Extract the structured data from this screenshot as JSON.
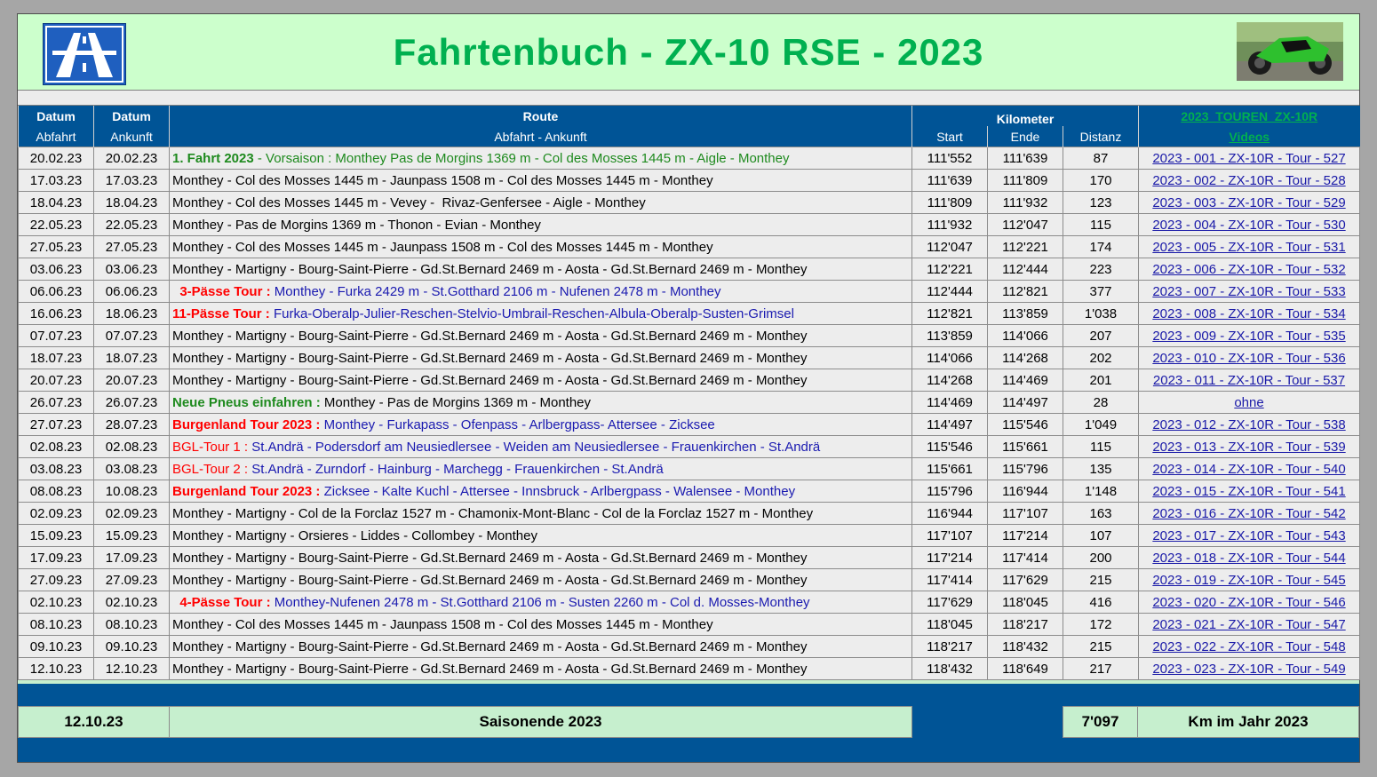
{
  "title": "Fahrtenbuch - ZX-10 RSE - 2023",
  "colors": {
    "header_blue": "#005496",
    "title_green": "#00b050",
    "red": "#ff0000",
    "blue": "#1a1ab0"
  },
  "icons": {
    "logo": "autobahn-sign-icon",
    "photo": "motorcycle-photo"
  },
  "columns": {
    "datum1": "Datum",
    "datum1_sub": "Abfahrt",
    "datum2": "Datum",
    "datum2_sub": "Ankunft",
    "route": "Route",
    "route_sub": "Abfahrt - Ankunft",
    "kilometer": "Kilometer",
    "start": "Start",
    "ende": "Ende",
    "distanz": "Distanz",
    "videos_link": "2023_TOUREN_ZX-10R",
    "videos": "Videos"
  },
  "rows": [
    {
      "abfahrt": "20.02.23",
      "ankunft": "20.02.23",
      "label": "1. Fahrt 2023",
      "label_style": "t-greenb",
      "route": " - Vorsaison : Monthey Pas de Morgins 1369 m - Col des Mosses 1445 m - Aigle - Monthey",
      "route_style": "t-green",
      "start": "111'552",
      "ende": "111'639",
      "distanz": "87",
      "video": "2023 - 001 - ZX-10R - Tour - 527"
    },
    {
      "abfahrt": "17.03.23",
      "ankunft": "17.03.23",
      "label": "",
      "label_style": "",
      "route": "Monthey - Col des Mosses 1445 m - Jaunpass 1508 m - Col des Mosses 1445 m - Monthey",
      "route_style": "t-black",
      "start": "111'639",
      "ende": "111'809",
      "distanz": "170",
      "video": "2023 - 002 - ZX-10R - Tour - 528"
    },
    {
      "abfahrt": "18.04.23",
      "ankunft": "18.04.23",
      "label": "",
      "label_style": "",
      "route": "Monthey - Col des Mosses 1445 m - Vevey -  Rivaz-Genfersee - Aigle - Monthey",
      "route_style": "t-black",
      "start": "111'809",
      "ende": "111'932",
      "distanz": "123",
      "video": "2023 - 003 - ZX-10R - Tour - 529"
    },
    {
      "abfahrt": "22.05.23",
      "ankunft": "22.05.23",
      "label": "",
      "label_style": "",
      "route": "Monthey - Pas de Morgins 1369 m - Thonon - Evian - Monthey",
      "route_style": "t-black",
      "start": "111'932",
      "ende": "112'047",
      "distanz": "115",
      "video": "2023 - 004 - ZX-10R - Tour - 530"
    },
    {
      "abfahrt": "27.05.23",
      "ankunft": "27.05.23",
      "label": "",
      "label_style": "",
      "route": "Monthey - Col des Mosses 1445 m - Jaunpass 1508 m - Col des Mosses 1445 m - Monthey",
      "route_style": "t-black",
      "start": "112'047",
      "ende": "112'221",
      "distanz": "174",
      "video": "2023 - 005 - ZX-10R - Tour - 531"
    },
    {
      "abfahrt": "03.06.23",
      "ankunft": "03.06.23",
      "label": "",
      "label_style": "",
      "route": "Monthey - Martigny - Bourg-Saint-Pierre - Gd.St.Bernard 2469 m - Aosta - Gd.St.Bernard 2469 m - Monthey",
      "route_style": "t-black",
      "start": "112'221",
      "ende": "112'444",
      "distanz": "223",
      "video": "2023 - 006 - ZX-10R - Tour - 532"
    },
    {
      "abfahrt": "06.06.23",
      "ankunft": "06.06.23",
      "label": "  3-Pässe Tour :",
      "label_style": "t-redb",
      "route": " Monthey - Furka 2429 m - St.Gotthard 2106 m - Nufenen 2478 m - Monthey",
      "route_style": "t-blue",
      "start": "112'444",
      "ende": "112'821",
      "distanz": "377",
      "video": "2023 - 007 - ZX-10R - Tour - 533"
    },
    {
      "abfahrt": "16.06.23",
      "ankunft": "18.06.23",
      "label": "11-Pässe Tour :",
      "label_style": "t-redb",
      "route": " Furka-Oberalp-Julier-Reschen-Stelvio-Umbrail-Reschen-Albula-Oberalp-Susten-Grimsel",
      "route_style": "t-blue",
      "start": "112'821",
      "ende": "113'859",
      "distanz": "1'038",
      "video": "2023 - 008 - ZX-10R - Tour - 534"
    },
    {
      "abfahrt": "07.07.23",
      "ankunft": "07.07.23",
      "label": "",
      "label_style": "",
      "route": "Monthey - Martigny - Bourg-Saint-Pierre - Gd.St.Bernard 2469 m - Aosta - Gd.St.Bernard 2469 m - Monthey",
      "route_style": "t-black",
      "start": "113'859",
      "ende": "114'066",
      "distanz": "207",
      "video": "2023 - 009 - ZX-10R - Tour - 535"
    },
    {
      "abfahrt": "18.07.23",
      "ankunft": "18.07.23",
      "label": "",
      "label_style": "",
      "route": "Monthey - Martigny - Bourg-Saint-Pierre - Gd.St.Bernard 2469 m - Aosta - Gd.St.Bernard 2469 m - Monthey",
      "route_style": "t-black",
      "start": "114'066",
      "ende": "114'268",
      "distanz": "202",
      "video": "2023 - 010 - ZX-10R - Tour - 536"
    },
    {
      "abfahrt": "20.07.23",
      "ankunft": "20.07.23",
      "label": "",
      "label_style": "",
      "route": "Monthey - Martigny - Bourg-Saint-Pierre - Gd.St.Bernard 2469 m - Aosta - Gd.St.Bernard 2469 m - Monthey",
      "route_style": "t-black",
      "start": "114'268",
      "ende": "114'469",
      "distanz": "201",
      "video": "2023 - 011 - ZX-10R - Tour - 537"
    },
    {
      "abfahrt": "26.07.23",
      "ankunft": "26.07.23",
      "label": "Neue Pneus einfahren :",
      "label_style": "t-greenb",
      "route": " Monthey - Pas de Morgins 1369 m - Monthey",
      "route_style": "t-black",
      "start": "114'469",
      "ende": "114'497",
      "distanz": "28",
      "video": "ohne"
    },
    {
      "abfahrt": "27.07.23",
      "ankunft": "28.07.23",
      "label": "Burgenland Tour 2023 :",
      "label_style": "t-redb",
      "route": " Monthey - Furkapass - Ofenpass - Arlbergpass- Attersee - Zicksee",
      "route_style": "t-blue",
      "start": "114'497",
      "ende": "115'546",
      "distanz": "1'049",
      "video": "2023 - 012 - ZX-10R - Tour - 538"
    },
    {
      "abfahrt": "02.08.23",
      "ankunft": "02.08.23",
      "label": "BGL-Tour 1 :",
      "label_style": "t-red",
      "route": " St.Andrä - Podersdorf am Neusiedlersee - Weiden am Neusiedlersee - Frauenkirchen - St.Andrä",
      "route_style": "t-blue",
      "start": "115'546",
      "ende": "115'661",
      "distanz": "115",
      "video": "2023 - 013 - ZX-10R - Tour - 539"
    },
    {
      "abfahrt": "03.08.23",
      "ankunft": "03.08.23",
      "label": "BGL-Tour 2 :",
      "label_style": "t-red",
      "route": " St.Andrä - Zurndorf - Hainburg - Marchegg - Frauenkirchen - St.Andrä",
      "route_style": "t-blue",
      "start": "115'661",
      "ende": "115'796",
      "distanz": "135",
      "video": "2023 - 014 - ZX-10R - Tour - 540"
    },
    {
      "abfahrt": "08.08.23",
      "ankunft": "10.08.23",
      "label": "Burgenland Tour 2023 :",
      "label_style": "t-redb",
      "route": " Zicksee - Kalte Kuchl - Attersee - Innsbruck - Arlbergpass - Walensee - Monthey",
      "route_style": "t-blue",
      "start": "115'796",
      "ende": "116'944",
      "distanz": "1'148",
      "video": "2023 - 015 - ZX-10R - Tour - 541"
    },
    {
      "abfahrt": "02.09.23",
      "ankunft": "02.09.23",
      "label": "",
      "label_style": "",
      "route": "Monthey - Martigny - Col de la Forclaz 1527 m - Chamonix-Mont-Blanc - Col de la Forclaz 1527 m - Monthey",
      "route_style": "t-black",
      "start": "116'944",
      "ende": "117'107",
      "distanz": "163",
      "video": "2023 - 016 - ZX-10R - Tour - 542"
    },
    {
      "abfahrt": "15.09.23",
      "ankunft": "15.09.23",
      "label": "",
      "label_style": "",
      "route": "Monthey - Martigny - Orsieres - Liddes - Collombey - Monthey",
      "route_style": "t-black",
      "start": "117'107",
      "ende": "117'214",
      "distanz": "107",
      "video": "2023 - 017 - ZX-10R - Tour - 543"
    },
    {
      "abfahrt": "17.09.23",
      "ankunft": "17.09.23",
      "label": "",
      "label_style": "",
      "route": "Monthey - Martigny - Bourg-Saint-Pierre - Gd.St.Bernard 2469 m - Aosta - Gd.St.Bernard 2469 m - Monthey",
      "route_style": "t-black",
      "start": "117'214",
      "ende": "117'414",
      "distanz": "200",
      "video": "2023 - 018 - ZX-10R - Tour - 544"
    },
    {
      "abfahrt": "27.09.23",
      "ankunft": "27.09.23",
      "label": "",
      "label_style": "",
      "route": "Monthey - Martigny - Bourg-Saint-Pierre - Gd.St.Bernard 2469 m - Aosta - Gd.St.Bernard 2469 m - Monthey",
      "route_style": "t-black",
      "start": "117'414",
      "ende": "117'629",
      "distanz": "215",
      "video": "2023 - 019 - ZX-10R - Tour - 545"
    },
    {
      "abfahrt": "02.10.23",
      "ankunft": "02.10.23",
      "label": "  4-Pässe Tour :",
      "label_style": "t-redb",
      "route": " Monthey-Nufenen 2478 m - St.Gotthard 2106 m - Susten 2260 m - Col d. Mosses-Monthey",
      "route_style": "t-blue",
      "start": "117'629",
      "ende": "118'045",
      "distanz": "416",
      "video": "2023 - 020 - ZX-10R - Tour - 546"
    },
    {
      "abfahrt": "08.10.23",
      "ankunft": "08.10.23",
      "label": "",
      "label_style": "",
      "route": "Monthey - Col des Mosses 1445 m - Jaunpass 1508 m - Col des Mosses 1445 m - Monthey",
      "route_style": "t-black",
      "start": "118'045",
      "ende": "118'217",
      "distanz": "172",
      "video": "2023 - 021 - ZX-10R - Tour - 547"
    },
    {
      "abfahrt": "09.10.23",
      "ankunft": "09.10.23",
      "label": "",
      "label_style": "",
      "route": "Monthey - Martigny - Bourg-Saint-Pierre - Gd.St.Bernard 2469 m - Aosta - Gd.St.Bernard 2469 m - Monthey",
      "route_style": "t-black",
      "start": "118'217",
      "ende": "118'432",
      "distanz": "215",
      "video": "2023 - 022 - ZX-10R - Tour - 548"
    },
    {
      "abfahrt": "12.10.23",
      "ankunft": "12.10.23",
      "label": "",
      "label_style": "",
      "route": "Monthey - Martigny - Bourg-Saint-Pierre - Gd.St.Bernard 2469 m - Aosta - Gd.St.Bernard 2469 m - Monthey",
      "route_style": "t-black",
      "start": "118'432",
      "ende": "118'649",
      "distanz": "217",
      "video": "2023 - 023 - ZX-10R - Tour - 549"
    }
  ],
  "footer": {
    "date": "12.10.23",
    "label": "Saisonende 2023",
    "total": "7'097",
    "total_label": "Km im Jahr 2023"
  }
}
